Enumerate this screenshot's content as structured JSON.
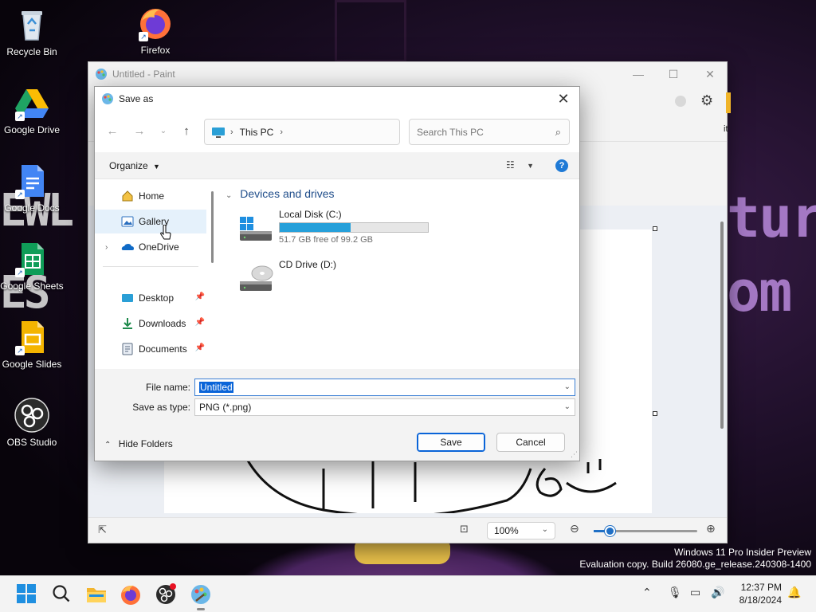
{
  "desktop": {
    "icons": [
      {
        "label": "Recycle Bin",
        "icon": "recycle-bin-icon"
      },
      {
        "label": "Firefox",
        "icon": "firefox-icon"
      },
      {
        "label": "Google Drive",
        "icon": "google-drive-icon"
      },
      {
        "label": "Google Docs",
        "icon": "google-docs-icon"
      },
      {
        "label": "Google Sheets",
        "icon": "google-sheets-icon"
      },
      {
        "label": "Google Slides",
        "icon": "google-slides-icon"
      },
      {
        "label": "OBS Studio",
        "icon": "obs-studio-icon"
      }
    ]
  },
  "paint": {
    "title": "Untitled - Paint",
    "zoom": "100%",
    "partial_text": "it"
  },
  "dialog": {
    "title": "Save as",
    "breadcrumb": [
      "This PC"
    ],
    "search_placeholder": "Search This PC",
    "organize_label": "Organize",
    "nav_items": [
      {
        "label": "Home",
        "icon": "home-icon"
      },
      {
        "label": "Gallery",
        "icon": "gallery-icon"
      },
      {
        "label": "OneDrive",
        "icon": "onedrive-icon"
      },
      {
        "label": "Desktop",
        "icon": "desktop-folder-icon"
      },
      {
        "label": "Downloads",
        "icon": "downloads-folder-icon"
      },
      {
        "label": "Documents",
        "icon": "documents-folder-icon"
      }
    ],
    "group_header": "Devices and drives",
    "drives": [
      {
        "name": "Local Disk (C:)",
        "free_text": "51.7 GB free of 99.2 GB",
        "used_fraction": 0.479
      },
      {
        "name": "CD Drive (D:)"
      }
    ],
    "file_name_label": "File name:",
    "file_name_value": "Untitled",
    "save_type_label": "Save as type:",
    "save_type_value": "PNG (*.png)",
    "hide_folders_label": "Hide Folders",
    "save_button": "Save",
    "cancel_button": "Cancel"
  },
  "watermark": {
    "line1": "Windows 11 Pro Insider Preview",
    "line2": "Evaluation copy. Build 26080.ge_release.240308-1400"
  },
  "taskbar": {
    "time": "12:37 PM",
    "date": "8/18/2024"
  },
  "colors": {
    "accent": "#0a64d8",
    "drive_bar": "#26a0da",
    "wallpaper_text": "#a478c4"
  }
}
